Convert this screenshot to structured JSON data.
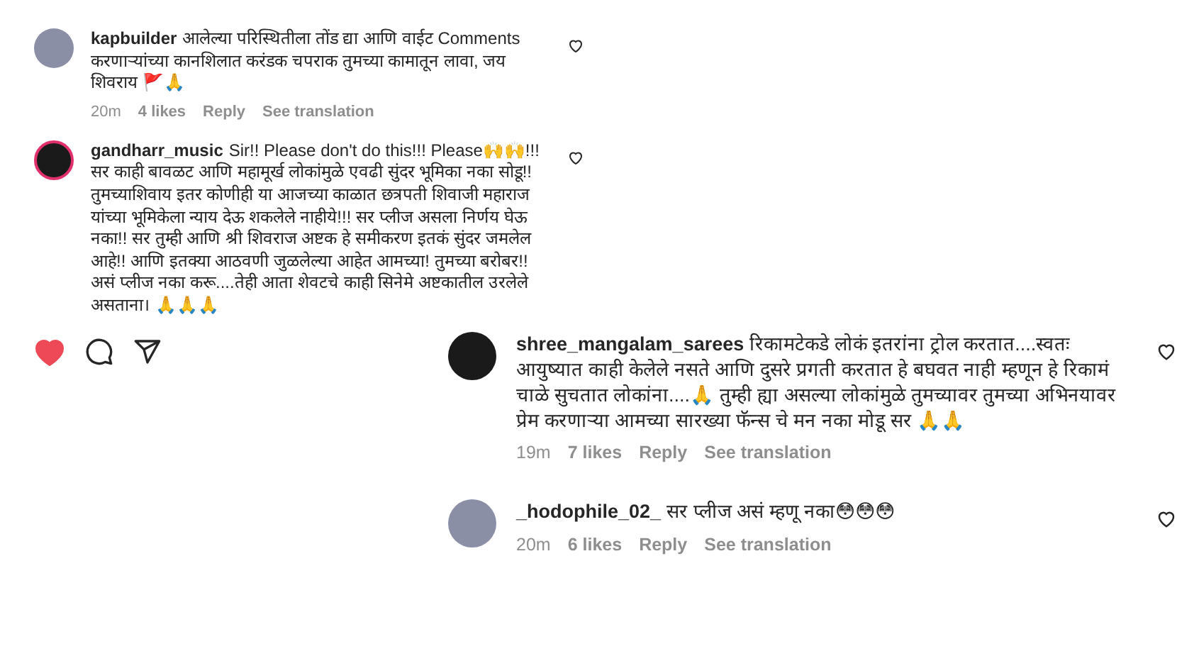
{
  "top_comments": [
    {
      "username": "kapbuilder",
      "text": "आलेल्या परिस्थितीला तोंड द्या आणि वाईट Comments करणाऱ्यांच्या कानशिलात करंडक चपराक तुमच्या कामातून लावा, जय शिवराय 🚩🙏",
      "story_ring": false,
      "footer": {
        "time": "20m",
        "likes": "4 likes",
        "reply": "Reply",
        "translate": "See translation"
      }
    },
    {
      "username": "gandharr_music",
      "text": "Sir!! Please don't do this!!! Please🙌🙌!!! सर काही बावळट आणि महामूर्ख लोकांमुळे एवढी सुंदर भूमिका नका सोडू!! तुमच्याशिवाय इतर कोणीही या आजच्या काळात छत्रपती शिवाजी महाराज यांच्या भूमिकेला न्याय देऊ शकलेले नाहीये!!! सर प्लीज असला निर्णय घेऊ नका!! सर तुम्ही आणि श्री शिवराज अष्टक हे समीकरण इतकं सुंदर जमलेल आहे!! आणि इतक्या आठवणी जुळलेल्या आहेत आमच्या! तुमच्या बरोबर!! असं प्लीज नका करू....तेही आता शेवटचे काही सिनेमे अष्टकातील उरलेले असताना। 🙏🙏🙏",
      "story_ring": true
    }
  ],
  "actions": {
    "liked": true
  },
  "bottom_comments": [
    {
      "username": "shree_mangalam_sarees",
      "text": "रिकामटेकडे लोकं इतरांना ट्रोल करतात....स्वतः आयुष्यात काही केलेले नसते आणि दुसरे प्रगती करतात हे बघवत नाही म्हणून हे रिकामं चाळे सुचतात लोकांना....🙏 तुम्ही ह्या असल्या लोकांमुळे तुमच्यावर तुमच्या अभिनयावर प्रेम करणाऱ्या आमच्या सारख्या फॅन्स चे मन नका मोडू सर 🙏🙏",
      "story_ring": false,
      "footer": {
        "time": "19m",
        "likes": "7 likes",
        "reply": "Reply",
        "translate": "See translation"
      }
    },
    {
      "username": "_hodophile_02_",
      "text": "सर प्लीज असं म्हणू नका😳😳😳",
      "story_ring": false,
      "footer": {
        "time": "20m",
        "likes": "6 likes",
        "reply": "Reply",
        "translate": "See translation"
      }
    }
  ]
}
